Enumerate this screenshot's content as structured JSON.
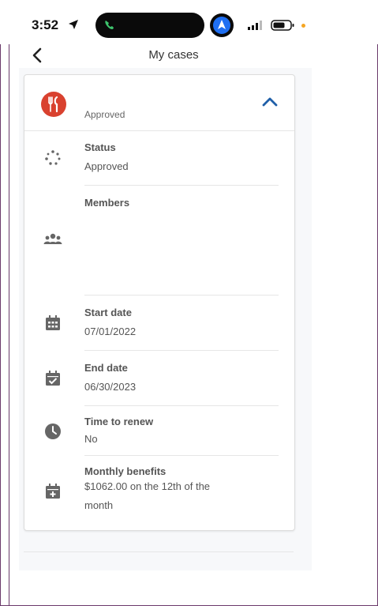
{
  "status_bar": {
    "time": "3:52"
  },
  "nav": {
    "title": "My cases"
  },
  "case": {
    "header_status": "Approved",
    "rows": [
      {
        "label": "Status",
        "value": "Approved",
        "icon": "loading-dots-icon"
      },
      {
        "label": "Members",
        "value": "",
        "icon": "group-icon"
      },
      {
        "label": "Start date",
        "value": "07/01/2022",
        "icon": "calendar-grid-icon"
      },
      {
        "label": "End date",
        "value": "06/30/2023",
        "icon": "calendar-check-icon"
      },
      {
        "label": "Time to renew",
        "value": "No",
        "icon": "clock-icon"
      },
      {
        "label": "Monthly benefits",
        "value": "$1062.00 on the 12th of the month",
        "icon": "calendar-plus-icon"
      }
    ]
  },
  "colors": {
    "accent": "#1f5fa8",
    "food_badge": "#d9412f",
    "icon_grey": "#666666"
  }
}
